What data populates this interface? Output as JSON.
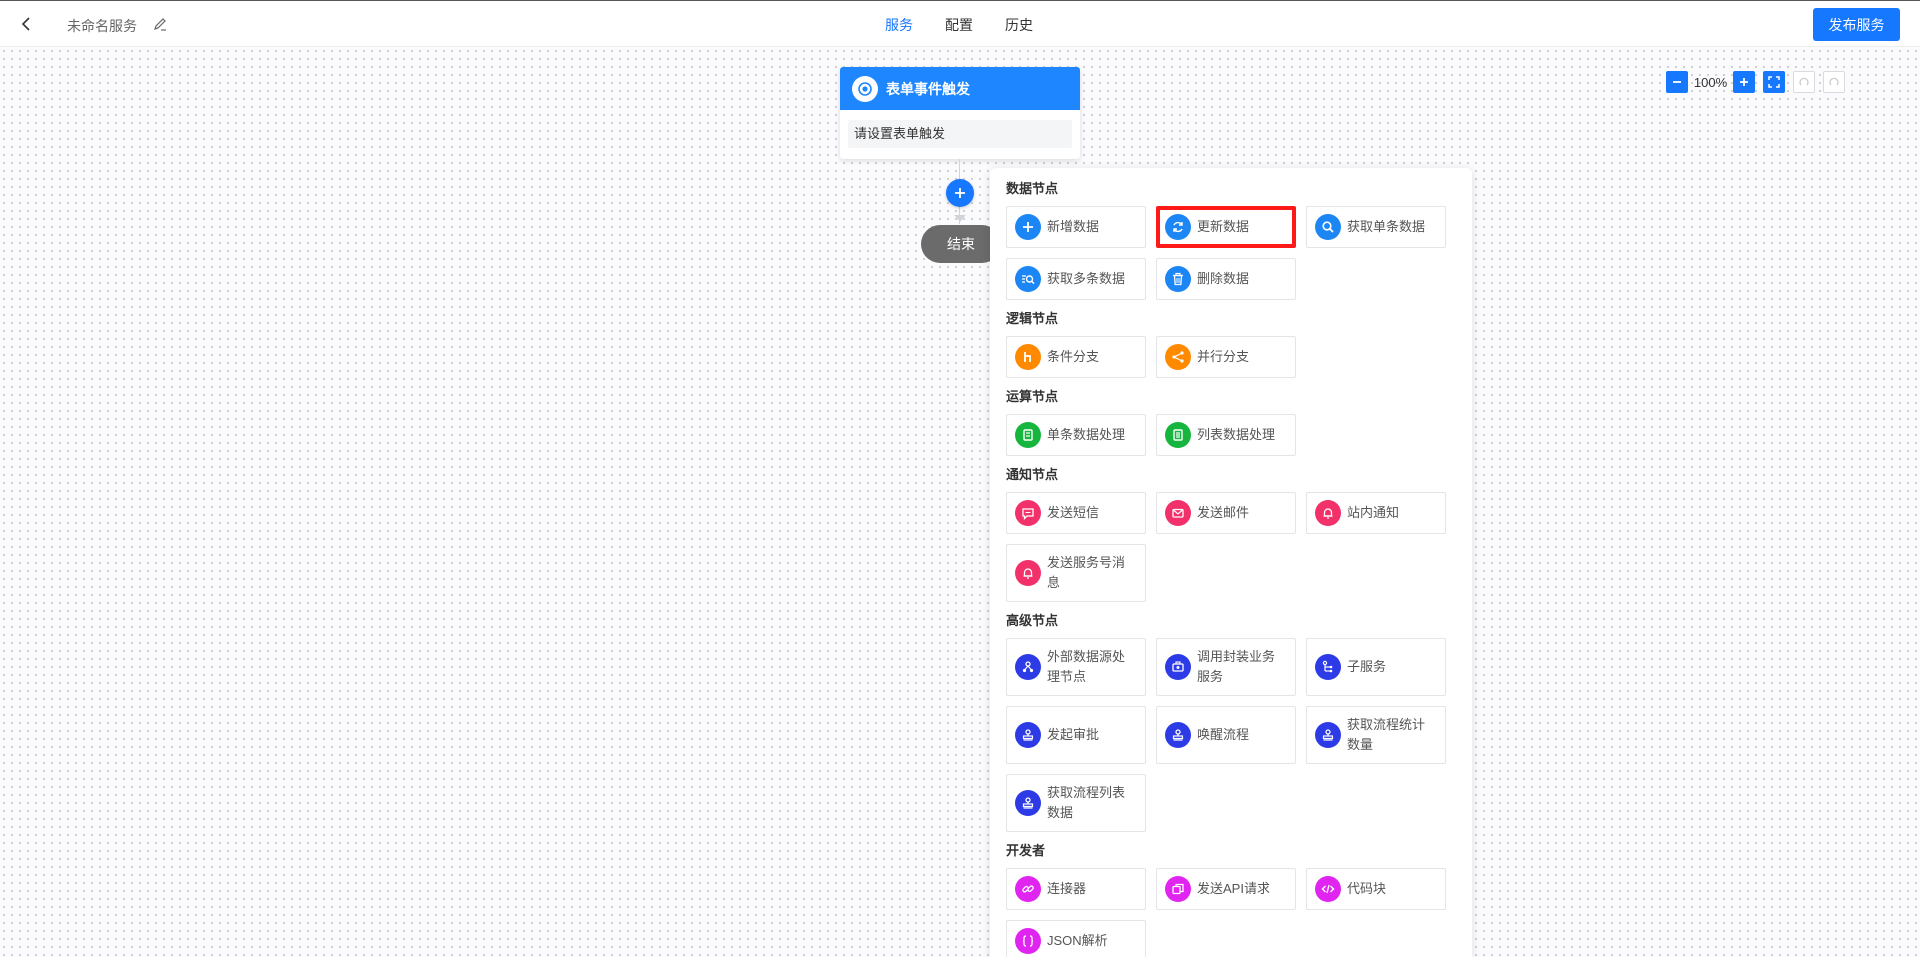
{
  "header": {
    "service_name": "未命名服务",
    "tabs": [
      {
        "label": "服务",
        "active": true
      },
      {
        "label": "配置",
        "active": false
      },
      {
        "label": "历史",
        "active": false
      }
    ],
    "publish_label": "发布服务"
  },
  "zoom": {
    "level": "100%"
  },
  "flow": {
    "trigger_title": "表单事件触发",
    "trigger_hint": "请设置表单触发",
    "end_label": "结束"
  },
  "colors": {
    "accent": "#1677ff",
    "data_nodes": "#1c86f5",
    "logic_nodes": "#ff8a00",
    "compute_nodes": "#16b53d",
    "notify_nodes": "#f2306a",
    "advanced_nodes": "#2c3be6",
    "developer_nodes": "#e025f0",
    "highlight": "#ff1a1a"
  },
  "panel": {
    "sections": [
      {
        "title": "数据节点",
        "items": [
          {
            "label": "新增数据",
            "icon": "plus-icon"
          },
          {
            "label": "更新数据",
            "icon": "refresh-icon"
          },
          {
            "label": "获取单条数据",
            "icon": "search-icon"
          },
          {
            "label": "获取多条数据",
            "icon": "multi-search-icon"
          },
          {
            "label": "删除数据",
            "icon": "trash-icon"
          }
        ]
      },
      {
        "title": "逻辑节点",
        "items": [
          {
            "label": "条件分支",
            "icon": "branch-icon"
          },
          {
            "label": "并行分支",
            "icon": "share-icon"
          }
        ]
      },
      {
        "title": "运算节点",
        "items": [
          {
            "label": "单条数据处理",
            "icon": "document-icon"
          },
          {
            "label": "列表数据处理",
            "icon": "list-icon"
          }
        ]
      },
      {
        "title": "通知节点",
        "items": [
          {
            "label": "发送短信",
            "icon": "message-icon"
          },
          {
            "label": "发送邮件",
            "icon": "mail-icon"
          },
          {
            "label": "站内通知",
            "icon": "bell-icon"
          },
          {
            "label": "发送服务号消息",
            "icon": "bell-icon"
          }
        ]
      },
      {
        "title": "高级节点",
        "items": [
          {
            "label": "外部数据源处理节点",
            "icon": "datasource-icon"
          },
          {
            "label": "调用封装业务服务",
            "icon": "service-icon"
          },
          {
            "label": "子服务",
            "icon": "subservice-icon"
          },
          {
            "label": "发起审批",
            "icon": "stamp-icon"
          },
          {
            "label": "唤醒流程",
            "icon": "stamp-icon"
          },
          {
            "label": "获取流程统计数量",
            "icon": "stamp-icon"
          },
          {
            "label": "获取流程列表数据",
            "icon": "stamp-icon"
          }
        ]
      },
      {
        "title": "开发者",
        "items": [
          {
            "label": "连接器",
            "icon": "link-icon"
          },
          {
            "label": "发送API请求",
            "icon": "api-icon"
          },
          {
            "label": "代码块",
            "icon": "code-icon"
          },
          {
            "label": "JSON解析",
            "icon": "json-icon"
          }
        ]
      }
    ]
  }
}
